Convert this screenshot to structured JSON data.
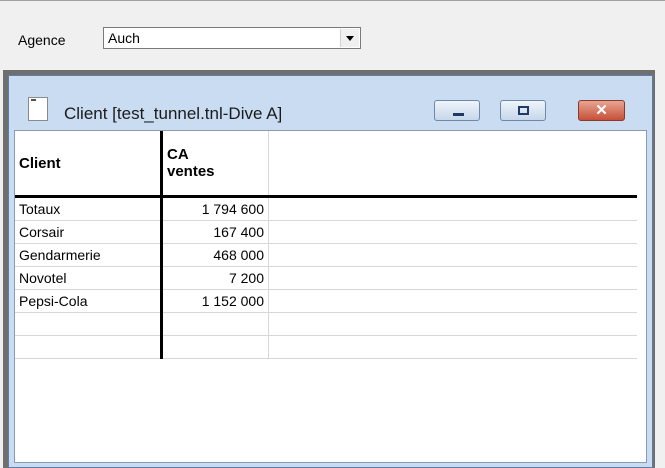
{
  "filter": {
    "label": "Agence",
    "value": "Auch"
  },
  "window": {
    "title": "Client [test_tunnel.tnl-Dive A]",
    "close_glyph": "✕"
  },
  "table": {
    "headers": {
      "client": "Client",
      "ca_line1": "CA",
      "ca_line2": "ventes"
    },
    "rows": [
      {
        "client": "Totaux",
        "ca": "1 794 600"
      },
      {
        "client": "Corsair",
        "ca": "167 400"
      },
      {
        "client": "Gendarmerie",
        "ca": "468 000"
      },
      {
        "client": "Novotel",
        "ca": "7 200"
      },
      {
        "client": "Pepsi-Cola",
        "ca": "1 152 000"
      },
      {
        "client": "",
        "ca": ""
      },
      {
        "client": "",
        "ca": ""
      }
    ]
  }
}
